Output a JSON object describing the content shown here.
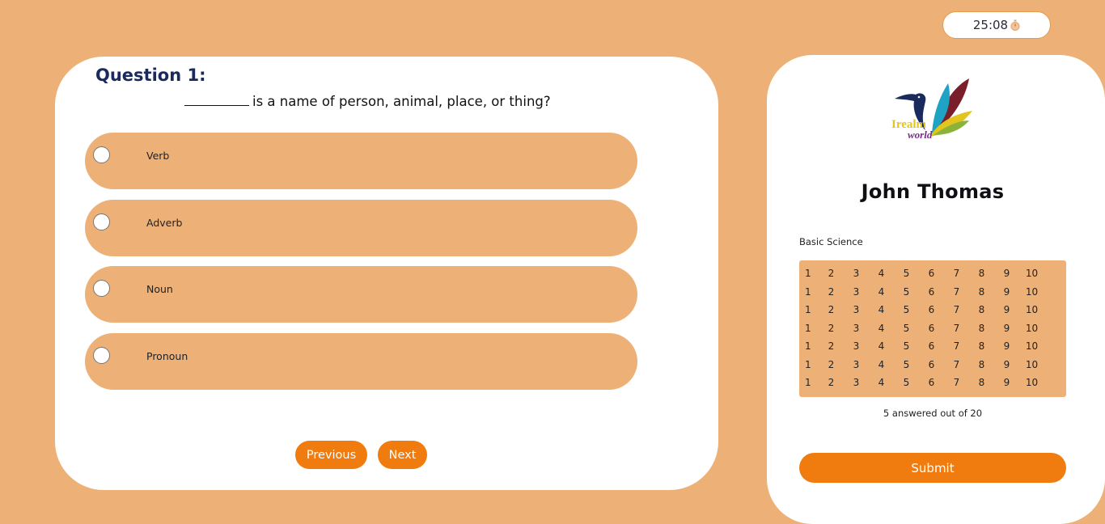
{
  "timer": {
    "value": "25:08",
    "icon": "stopwatch-icon"
  },
  "question": {
    "title": "Question 1:",
    "text": "is a name of person, animal, place, or thing?",
    "options": [
      "Verb",
      "Adverb",
      "Noun",
      "Pronoun"
    ]
  },
  "nav": {
    "previous_label": "Previous",
    "next_label": "Next"
  },
  "profile": {
    "logo_text_1": "Irealm",
    "logo_text_2": "world",
    "name": "John Thomas",
    "subject": "Basic Science",
    "grid": [
      [
        "1",
        "2",
        "3",
        "4",
        "5",
        "6",
        "7",
        "8",
        "9",
        "10"
      ],
      [
        "1",
        "2",
        "3",
        "4",
        "5",
        "6",
        "7",
        "8",
        "9",
        "10"
      ],
      [
        "1",
        "2",
        "3",
        "4",
        "5",
        "6",
        "7",
        "8",
        "9",
        "10"
      ],
      [
        "1",
        "2",
        "3",
        "4",
        "5",
        "6",
        "7",
        "8",
        "9",
        "10"
      ],
      [
        "1",
        "2",
        "3",
        "4",
        "5",
        "6",
        "7",
        "8",
        "9",
        "10"
      ],
      [
        "1",
        "2",
        "3",
        "4",
        "5",
        "6",
        "7",
        "8",
        "9",
        "10"
      ],
      [
        "1",
        "2",
        "3",
        "4",
        "5",
        "6",
        "7",
        "8",
        "9",
        "10"
      ]
    ],
    "answered_text": "5 answered out of 20",
    "submit_label": "Submit"
  },
  "colors": {
    "background": "#EDB177",
    "accent": "#F07B0E",
    "title": "#1B2A5C"
  }
}
